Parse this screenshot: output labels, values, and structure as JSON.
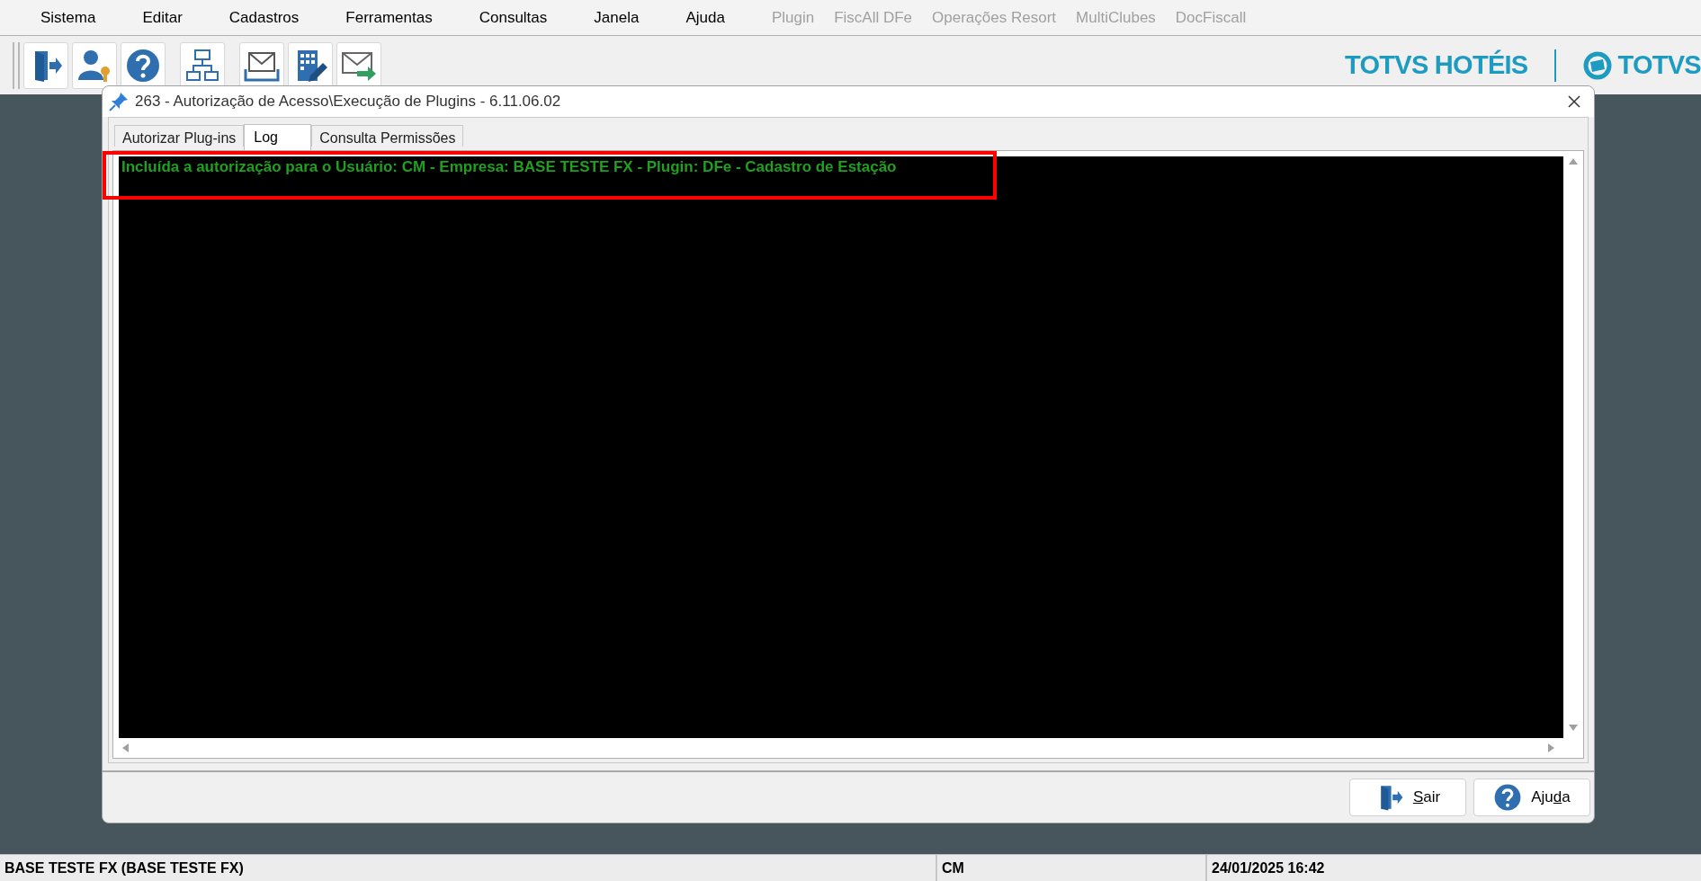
{
  "menu": [
    {
      "label": "Sistema",
      "disabled": false
    },
    {
      "label": "Editar",
      "disabled": false
    },
    {
      "label": "Cadastros",
      "disabled": false
    },
    {
      "label": "Ferramentas",
      "disabled": false
    },
    {
      "label": "Consultas",
      "disabled": false
    },
    {
      "label": "Janela",
      "disabled": false
    },
    {
      "label": "Ajuda",
      "disabled": false
    },
    {
      "label": "Plugin",
      "disabled": true
    },
    {
      "label": "FiscAll DFe",
      "disabled": true
    },
    {
      "label": "Operações Resort",
      "disabled": true
    },
    {
      "label": "MultiClubes",
      "disabled": true
    },
    {
      "label": "DocFiscall",
      "disabled": true
    }
  ],
  "toolbar": [
    {
      "kind": "exit"
    },
    {
      "kind": "user-key"
    },
    {
      "kind": "help"
    },
    {
      "kind": "network"
    },
    {
      "kind": "inbox"
    },
    {
      "kind": "building-edit"
    },
    {
      "kind": "mail-send"
    }
  ],
  "brand": {
    "product": "TOTVS HOTÉIS",
    "company": "TOTVS"
  },
  "window": {
    "title": "263 - Autorização de Acesso\\Execução de Plugins - 6.11.06.02"
  },
  "tabs": [
    {
      "label": "Autorizar Plug-ins",
      "selected": false
    },
    {
      "label": "Log",
      "selected": true
    },
    {
      "label": "Consulta Permissões",
      "selected": false
    }
  ],
  "log": [
    "Incluída a autorização para o Usuário: CM - Empresa: BASE TESTE FX - Plugin: DFe - Cadastro de Estação"
  ],
  "highlight": {
    "shown": true
  },
  "buttons": [
    {
      "kind": "exit",
      "label": "Sair"
    },
    {
      "kind": "help",
      "label": "Ajuda"
    }
  ],
  "status_bar": [
    "BASE TESTE FX (BASE TESTE FX)",
    "CM",
    "24/01/2025 16:42"
  ]
}
